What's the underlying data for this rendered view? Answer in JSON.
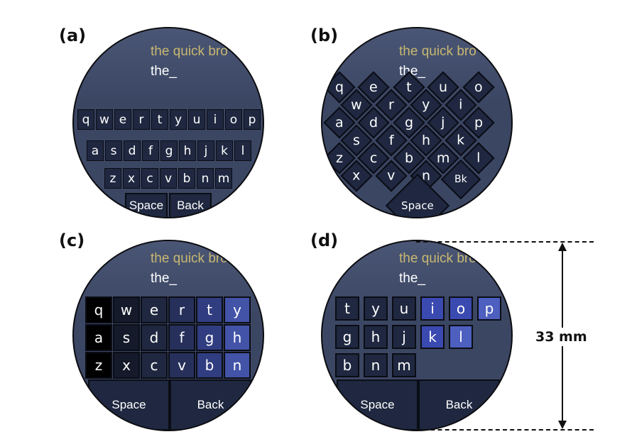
{
  "panels": {
    "a": {
      "label": "(a)",
      "phrase": "the quick bro",
      "typed": "the_",
      "rows": [
        [
          "q",
          "w",
          "e",
          "r",
          "t",
          "y",
          "u",
          "i",
          "o",
          "p"
        ],
        [
          "a",
          "s",
          "d",
          "f",
          "g",
          "h",
          "j",
          "k",
          "l"
        ],
        [
          "z",
          "x",
          "c",
          "v",
          "b",
          "n",
          "m"
        ]
      ],
      "space": "Space",
      "back": "Back"
    },
    "b": {
      "label": "(b)",
      "phrase": "the quick bro",
      "typed": "the_",
      "keys": [
        "q",
        "e",
        "t",
        "u",
        "o",
        "w",
        "r",
        "y",
        "i",
        "a",
        "d",
        "g",
        "j",
        "p",
        "s",
        "f",
        "h",
        "k",
        "z",
        "c",
        "b",
        "m",
        "l",
        "x",
        "v",
        "n",
        "Bk"
      ],
      "space": "Space"
    },
    "c": {
      "label": "(c)",
      "phrase": "the quick bro",
      "typed": "the_",
      "rows": [
        [
          "q",
          "w",
          "e",
          "r",
          "t",
          "y"
        ],
        [
          "a",
          "s",
          "d",
          "f",
          "g",
          "h"
        ],
        [
          "z",
          "x",
          "c",
          "v",
          "b",
          "n"
        ]
      ],
      "space": "Space",
      "back": "Back"
    },
    "d": {
      "label": "(d)",
      "phrase": "the quick bro",
      "typed": "the_",
      "rows": [
        [
          "t",
          "y",
          "u",
          "i",
          "o",
          "p"
        ],
        [
          "g",
          "h",
          "j",
          "k",
          "l"
        ],
        [
          "b",
          "n",
          "m"
        ]
      ],
      "space": "Space",
      "back": "Back"
    }
  },
  "dimension": {
    "label": "33 mm"
  },
  "colors": {
    "face": "#3b4663",
    "key": "#1f2840",
    "phrase": "#c9b871",
    "highlight": "#4d5fbf",
    "dark": "#000000"
  }
}
